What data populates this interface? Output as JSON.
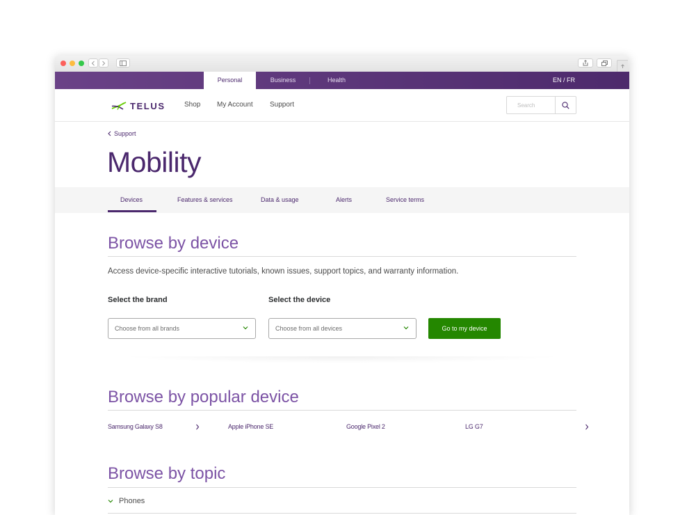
{
  "browser": {
    "icons": [
      "back-icon",
      "forward-icon",
      "sidebar-icon",
      "share-icon",
      "tabs-icon",
      "new-tab-icon"
    ]
  },
  "topbar": {
    "tabs": [
      {
        "label": "Personal"
      },
      {
        "label": "Business"
      },
      {
        "label": "Health"
      }
    ],
    "lang": "EN / FR",
    "color": "#4b286d"
  },
  "header": {
    "logo_text": "TELUS",
    "nav": [
      {
        "label": "Shop"
      },
      {
        "label": "My Account"
      },
      {
        "label": "Support"
      }
    ],
    "search_placeholder": "Search"
  },
  "breadcrumb": {
    "label": "Support"
  },
  "page_title": "Mobility",
  "subtabs": [
    {
      "label": "Devices",
      "active": true
    },
    {
      "label": "Features & services"
    },
    {
      "label": "Data & usage"
    },
    {
      "label": "Alerts"
    },
    {
      "label": "Service terms"
    }
  ],
  "browse_device": {
    "title": "Browse by device",
    "description": "Access device-specific interactive tutorials, known issues, support topics, and warranty information.",
    "brand_label": "Select the brand",
    "brand_value": "Choose from all brands",
    "device_label": "Select the device",
    "device_value": "Choose from all devices",
    "button_label": "Go to my device",
    "button_color": "#248700"
  },
  "popular": {
    "title": "Browse by popular device",
    "items": [
      {
        "label": "Samsung Galaxy S8"
      },
      {
        "label": "Apple iPhone SE"
      },
      {
        "label": "Google Pixel 2"
      },
      {
        "label": "LG G7"
      }
    ]
  },
  "topics": {
    "title": "Browse by topic",
    "items": [
      {
        "label": "Phones"
      }
    ]
  },
  "accent_colors": {
    "purple": "#4b286d",
    "light_purple": "#7c53a5",
    "green": "#248700"
  }
}
